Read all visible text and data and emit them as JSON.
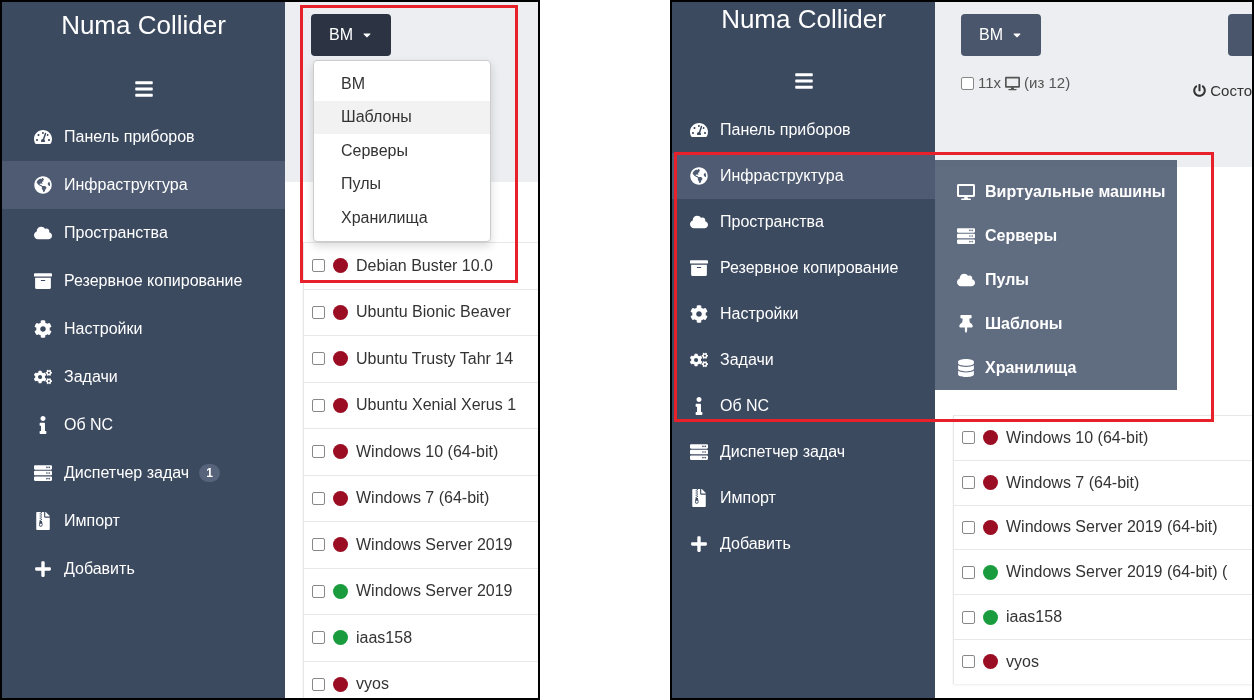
{
  "panels": [
    {
      "sidebar": {
        "title": "Numa Collider",
        "items": [
          {
            "label": "Панель приборов",
            "selected": false
          },
          {
            "label": "Инфраструктура",
            "selected": true
          },
          {
            "label": "Пространства",
            "selected": false
          },
          {
            "label": "Резервное копирование",
            "selected": false
          },
          {
            "label": "Настройки",
            "selected": false
          },
          {
            "label": "Задачи",
            "selected": false
          },
          {
            "label": "Об NC",
            "selected": false
          },
          {
            "label": "Диспетчер задач",
            "selected": false,
            "badge": "1"
          },
          {
            "label": "Импорт",
            "selected": false
          },
          {
            "label": "Добавить",
            "selected": false
          }
        ]
      },
      "view_button": "ВМ",
      "dropdown": [
        {
          "label": "ВМ",
          "selected": false
        },
        {
          "label": "Шаблоны",
          "selected": true
        },
        {
          "label": "Серверы",
          "selected": false
        },
        {
          "label": "Пулы",
          "selected": false
        },
        {
          "label": "Хранилища",
          "selected": false
        }
      ],
      "rows": [
        {
          "name": "Debian Buster 10.0",
          "checked": false,
          "color": "#9b0d23"
        },
        {
          "name": "Ubuntu Bionic Beaver",
          "checked": false,
          "color": "#9b0d23"
        },
        {
          "name": "Ubuntu Trusty Tahr 14",
          "checked": false,
          "color": "#9b0d23"
        },
        {
          "name": "Ubuntu Xenial Xerus 1",
          "checked": false,
          "color": "#9b0d23"
        },
        {
          "name": "Windows 10 (64-bit)",
          "checked": false,
          "color": "#9b0d23"
        },
        {
          "name": "Windows 7 (64-bit)",
          "checked": false,
          "color": "#9b0d23"
        },
        {
          "name": "Windows Server 2019",
          "checked": false,
          "color": "#9b0d23"
        },
        {
          "name": "Windows Server 2019",
          "checked": false,
          "color": "#1a9c3e"
        },
        {
          "name": "iaas158",
          "checked": false,
          "color": "#1a9c3e"
        },
        {
          "name": "vyos",
          "checked": false,
          "color": "#9b0d23"
        }
      ]
    },
    {
      "sidebar": {
        "title": "Numa Collider",
        "items": [
          {
            "label": "Панель приборов",
            "selected": false
          },
          {
            "label": "Инфраструктура",
            "selected": true
          },
          {
            "label": "Пространства",
            "selected": false
          },
          {
            "label": "Резервное копирование",
            "selected": false
          },
          {
            "label": "Настройки",
            "selected": false
          },
          {
            "label": "Задачи",
            "selected": false
          },
          {
            "label": "Об NC",
            "selected": false
          },
          {
            "label": "Диспетчер задач",
            "selected": false
          },
          {
            "label": "Импорт",
            "selected": false
          },
          {
            "label": "Добавить",
            "selected": false
          }
        ]
      },
      "view_button": "ВМ",
      "selection": {
        "checked": false,
        "count": "11x",
        "total": "(из 12)",
        "state_label": "Состо"
      },
      "flyout": [
        "Виртуальные машины",
        "Серверы",
        "Пулы",
        "Шаблоны",
        "Хранилища"
      ],
      "rows": [
        {
          "name": "Windows 10 (64-bit)",
          "checked": false,
          "color": "#9b0d23"
        },
        {
          "name": "Windows 7 (64-bit)",
          "checked": false,
          "color": "#9b0d23"
        },
        {
          "name": "Windows Server 2019 (64-bit)",
          "checked": false,
          "color": "#9b0d23"
        },
        {
          "name": "Windows Server 2019 (64-bit) (",
          "checked": false,
          "color": "#1a9c3e"
        },
        {
          "name": "iaas158",
          "checked": false,
          "color": "#1a9c3e"
        },
        {
          "name": "vyos",
          "checked": false,
          "color": "#9b0d23"
        }
      ]
    }
  ]
}
